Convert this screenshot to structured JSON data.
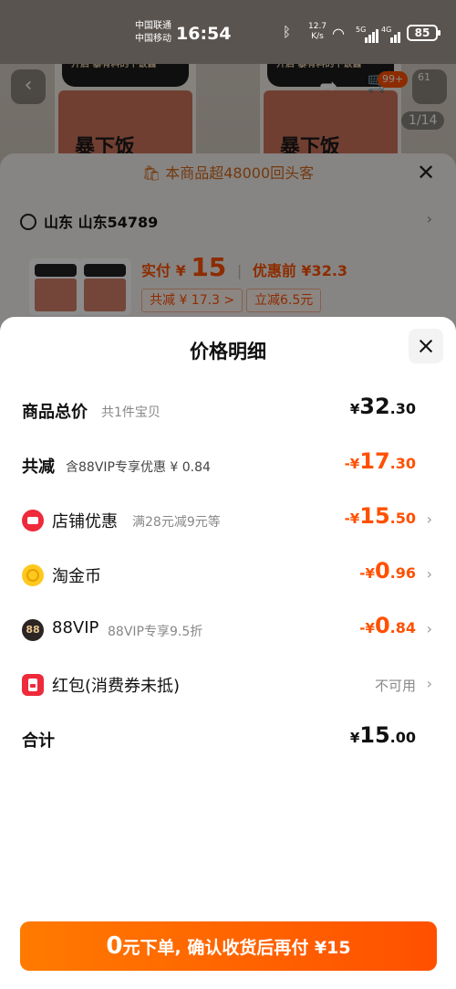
{
  "status_bar": {
    "carrier_1": "中国联通",
    "carrier_2": "中国移动",
    "time": "16:54",
    "net_speed_value": "12.7",
    "net_speed_unit": "K/s",
    "net_tag_1": "5G",
    "net_tag_2": "4G",
    "battery": "85",
    "icons": [
      "bluetooth-icon",
      "wifi-icon",
      "signal-icon",
      "battery-icon"
    ]
  },
  "background": {
    "jar_label": "开启 暴有料的下饭酱",
    "brand": "暴下饭",
    "cart_badge": "99+",
    "more_badge": "61",
    "photo_index": "1/14",
    "repeat_banner": "本商品超48000回头客",
    "address": "山东 山东54789",
    "pay_label": "实付",
    "pay_currency": "¥",
    "pay_amount": "15",
    "orig_label": "优惠前",
    "orig_price": "¥32.3",
    "discount_chip": "共减 ¥ 17.3 >",
    "instant_chip": "立减6.5元"
  },
  "sheet": {
    "title": "价格明细",
    "rows": [
      {
        "label": "商品总价",
        "sub": "共1件宝贝",
        "currency": "¥",
        "int": "32",
        "dec": ".30"
      },
      {
        "label": "共减",
        "sub": "含88VIP专享优惠 ¥ 0.84",
        "currency": "-¥",
        "int": "17",
        "dec": ".30"
      },
      {
        "label": "店铺优惠",
        "sub": "满28元减9元等",
        "currency": "-¥",
        "int": "15",
        "dec": ".50",
        "icon": "shop-icon"
      },
      {
        "label": "淘金币",
        "sub": "",
        "currency": "-¥",
        "int": "0",
        "dec": ".96",
        "icon": "coin-icon"
      },
      {
        "label": "88VIP",
        "sub": "88VIP专享9.5折",
        "currency": "-¥",
        "int": "0",
        "dec": ".84",
        "icon": "vip-88-icon",
        "icon_text": "88"
      },
      {
        "label": "红包(消费券未抵)",
        "sub": "",
        "status": "不可用",
        "icon": "red-packet-icon"
      },
      {
        "label": "合计",
        "sub": "",
        "currency": "¥",
        "int": "15",
        "dec": ".00"
      }
    ]
  },
  "cta": {
    "big_zero": "0",
    "text": "元下单, 确认收货后再付 ¥15"
  },
  "colors": {
    "accent": "#ff5000",
    "shop_red": "#ee2a3b",
    "coin_yellow": "#ffc81e",
    "vip_dark": "#2b2523"
  }
}
